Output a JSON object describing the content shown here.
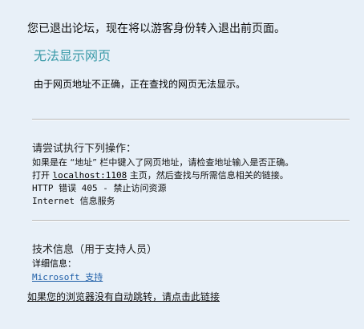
{
  "forum": {
    "logout_message": "您已退出论坛，现在将以游客身份转入退出前页面。",
    "redirect_link": "如果您的浏览器没有自动跳转，请点击此链接"
  },
  "error_page": {
    "title": "无法显示网页",
    "description": "由于网页地址不正确，正在查找的网页无法显示。",
    "try_title": "请尝试执行下列操作：",
    "line1": "如果是在 “地址” 栏中键入了网页地址，请检查地址输入是否正确。",
    "line2_prefix": "打开 ",
    "line2_link": "localhost:1108",
    "line2_suffix": " 主页，然后查找与所需信息相关的链接。",
    "line3": "HTTP 错误 405 - 禁止访问资源",
    "line4": "Internet 信息服务",
    "tech_title": "技术信息（用于支持人员）",
    "detail_label": "详细信息：",
    "support_link": "Microsoft 支持"
  },
  "colors": {
    "background": "#e8f0f8",
    "title": "#3a9aa8",
    "link": "#1f5fa8"
  }
}
